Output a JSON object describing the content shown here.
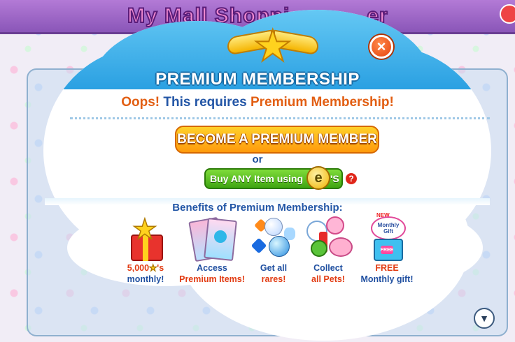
{
  "background": {
    "title": "My Mall Shoppi",
    "title_suffix": "er"
  },
  "modal": {
    "title": "PREMIUM MEMBERSHIP",
    "close_label": "×",
    "oops": {
      "part1": "Oops!",
      "part2": " This requires ",
      "part3": "Premium Membership!"
    },
    "become_button": "BECOME A PREMIUM MEMBER",
    "or_text": "or",
    "buy_button": "Buy ANY Item using",
    "buy_coin_letter": "e",
    "buy_suffix": "'S",
    "help_label": "?",
    "benefits_title": "Benefits of Premium Membership:",
    "benefits": [
      {
        "icon": "gift-star-icon",
        "line1": "5,000",
        "line1_suffix": "'s",
        "line2": "monthly!",
        "line1_color": "red",
        "line2_color": "blue"
      },
      {
        "icon": "magazines-icon",
        "line1": "Access",
        "line2": "Premium Items!",
        "line1_color": "blue",
        "line2_color": "red"
      },
      {
        "icon": "rares-icon",
        "line1": "Get all",
        "line2": "rares!",
        "line1_color": "blue",
        "line2_color": "red"
      },
      {
        "icon": "pets-icon",
        "line1": "Collect",
        "line2": "all Pets!",
        "line1_color": "blue",
        "line2_color": "red"
      },
      {
        "icon": "monthly-gift-icon",
        "line1": "FREE",
        "line2": "Monthly gift!",
        "line1_color": "red",
        "line2_color": "blue"
      }
    ],
    "gift_badge": {
      "new": "NEW",
      "text": "Monthly Gift",
      "free": "FREE"
    }
  },
  "scroll_down_label": "▼",
  "colors": {
    "header_blue": "#2a9ee0",
    "accent_orange": "#ff9a0c",
    "accent_green": "#3fa512",
    "text_blue": "#1f4fa0",
    "text_red": "#e23b12"
  }
}
